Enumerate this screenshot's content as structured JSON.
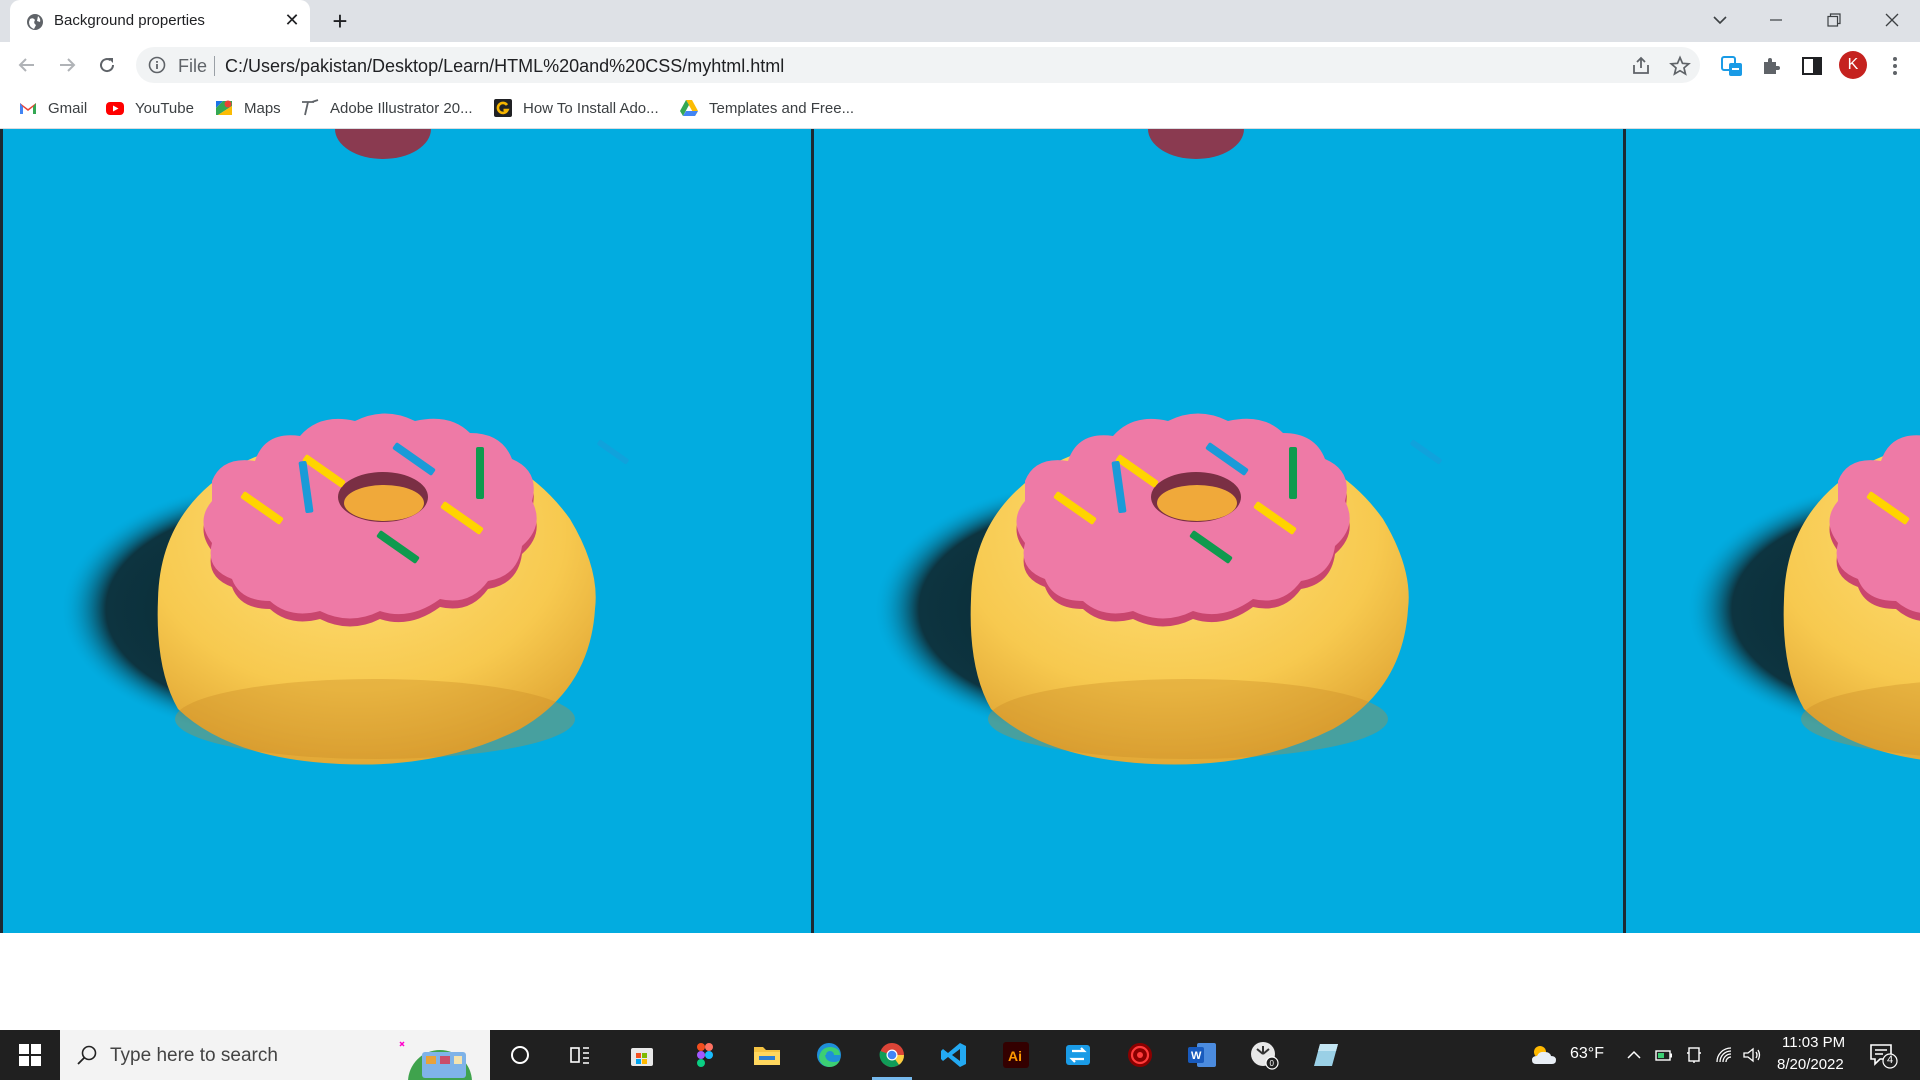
{
  "browser": {
    "tab_title": "Background properties",
    "omnibox_scheme": "File",
    "omnibox_url": "C:/Users/pakistan/Desktop/Learn/HTML%20and%20CSS/myhtml.html",
    "profile_initial": "K"
  },
  "bookmarks": [
    {
      "label": "Gmail",
      "icon": "gmail-icon"
    },
    {
      "label": "YouTube",
      "icon": "youtube-icon"
    },
    {
      "label": "Maps",
      "icon": "maps-icon"
    },
    {
      "label": "Adobe Illustrator 20...",
      "icon": "pen-icon"
    },
    {
      "label": "How To Install Ado...",
      "icon": "g-icon"
    },
    {
      "label": "Templates and Free...",
      "icon": "drive-icon"
    }
  ],
  "page": {
    "background_color": "#02ace0",
    "image": "donut-illustration"
  },
  "taskbar": {
    "search_placeholder": "Type here to search",
    "weather_temp": "63°F",
    "time": "11:03 PM",
    "date": "8/20/2022",
    "notification_count": "4"
  },
  "colors": {
    "accent_blue": "#02ace0",
    "donut_dough": "#f7c94f",
    "donut_frosting": "#ee7aa6",
    "taskbar_bg": "#202020"
  }
}
